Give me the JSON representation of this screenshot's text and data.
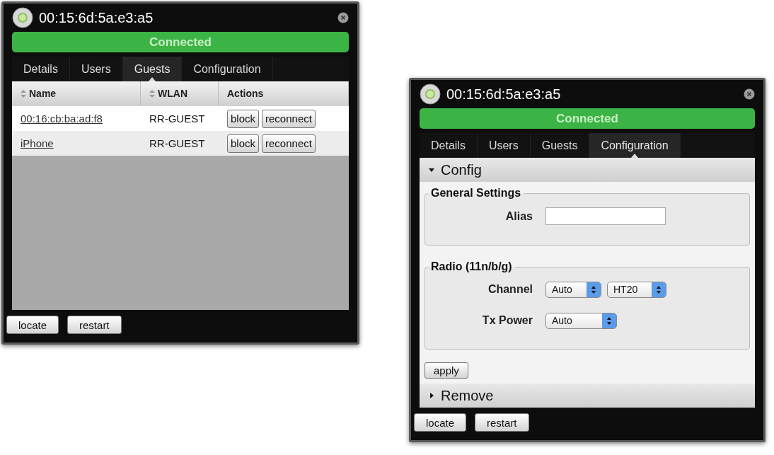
{
  "panels": [
    {
      "kind": "guests",
      "title": "00:15:6d:5a:e3:a5",
      "status": "Connected",
      "tabs": [
        {
          "label": "Details",
          "selected": false
        },
        {
          "label": "Users",
          "selected": false
        },
        {
          "label": "Guests",
          "selected": true
        },
        {
          "label": "Configuration",
          "selected": false
        }
      ],
      "table": {
        "columns": [
          "Name",
          "WLAN",
          "Actions"
        ],
        "rows": [
          {
            "name": "00:16:cb:ba:ad:f8",
            "wlan": "RR-GUEST",
            "actions": [
              "block",
              "reconnect"
            ]
          },
          {
            "name": "iPhone",
            "wlan": "RR-GUEST",
            "actions": [
              "block",
              "reconnect"
            ]
          }
        ]
      },
      "footer_buttons": [
        "locate",
        "restart"
      ]
    },
    {
      "kind": "config",
      "title": "00:15:6d:5a:e3:a5",
      "status": "Connected",
      "tabs": [
        {
          "label": "Details",
          "selected": false
        },
        {
          "label": "Users",
          "selected": false
        },
        {
          "label": "Guests",
          "selected": false
        },
        {
          "label": "Configuration",
          "selected": true
        }
      ],
      "sections": [
        {
          "title": "Config",
          "expanded": true,
          "groups": [
            {
              "legend": "General Settings",
              "fields": [
                {
                  "label": "Alias",
                  "kind": "text"
                }
              ]
            },
            {
              "legend": "Radio (11n/b/g)",
              "fields": [
                {
                  "label": "Channel",
                  "kind": "selects",
                  "selects": [
                    "Auto",
                    "HT20"
                  ]
                },
                {
                  "label": "Tx Power",
                  "kind": "select",
                  "selects": [
                    "Auto"
                  ]
                }
              ]
            }
          ],
          "apply": "apply"
        },
        {
          "title": "Remove",
          "expanded": false
        }
      ],
      "footer_buttons": [
        "locate",
        "restart"
      ]
    }
  ]
}
